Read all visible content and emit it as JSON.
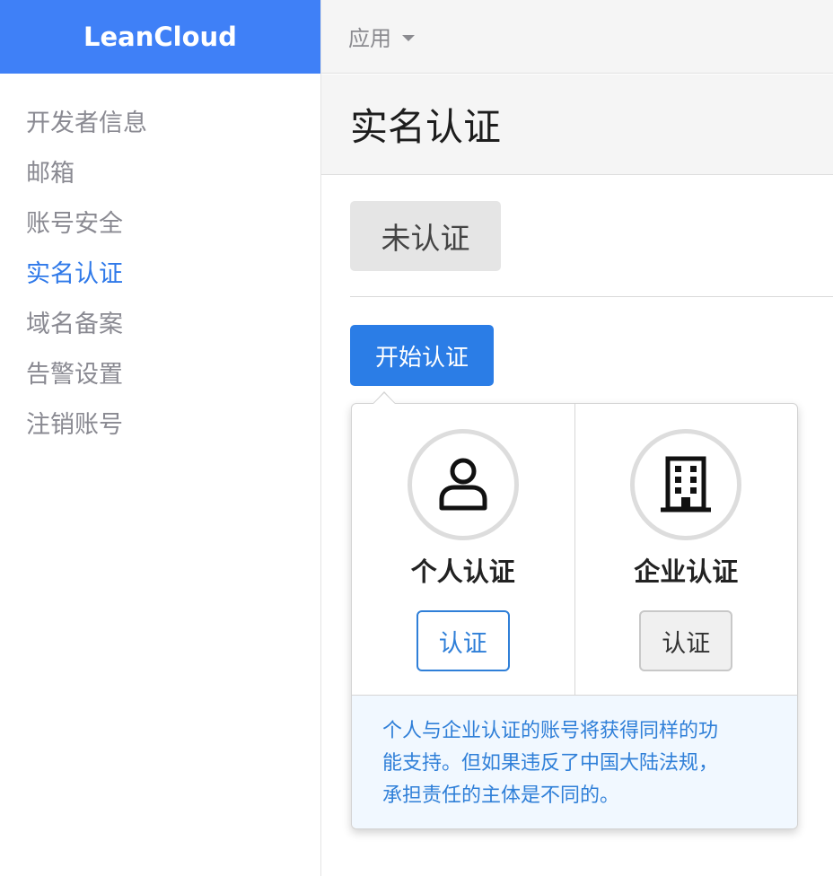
{
  "brand": {
    "name": "LeanCloud",
    "color": "#3f80f7"
  },
  "sidebar": {
    "items": [
      {
        "label": "开发者信息",
        "active": false
      },
      {
        "label": "邮箱",
        "active": false
      },
      {
        "label": "账号安全",
        "active": false
      },
      {
        "label": "实名认证",
        "active": true
      },
      {
        "label": "域名备案",
        "active": false
      },
      {
        "label": "告警设置",
        "active": false
      },
      {
        "label": "注销账号",
        "active": false
      }
    ]
  },
  "topbar": {
    "app_switch_label": "应用",
    "icon": "caret-down-icon"
  },
  "page": {
    "title": "实名认证",
    "status": "未认证",
    "start_button": "开始认证"
  },
  "popover": {
    "options": [
      {
        "icon": "person-icon",
        "title": "个人认证",
        "button": "认证"
      },
      {
        "icon": "building-icon",
        "title": "企业认证",
        "button": "认证"
      }
    ],
    "note_lines": [
      "个人与企业认证的账号将获得同样的功",
      "能支持。但如果违反了中国大陆法规，",
      "承担责任的主体是不同的。"
    ]
  },
  "colors": {
    "accent": "#2b7de6",
    "active_nav": "#2f79e9",
    "note_bg": "#f1f8ff"
  }
}
